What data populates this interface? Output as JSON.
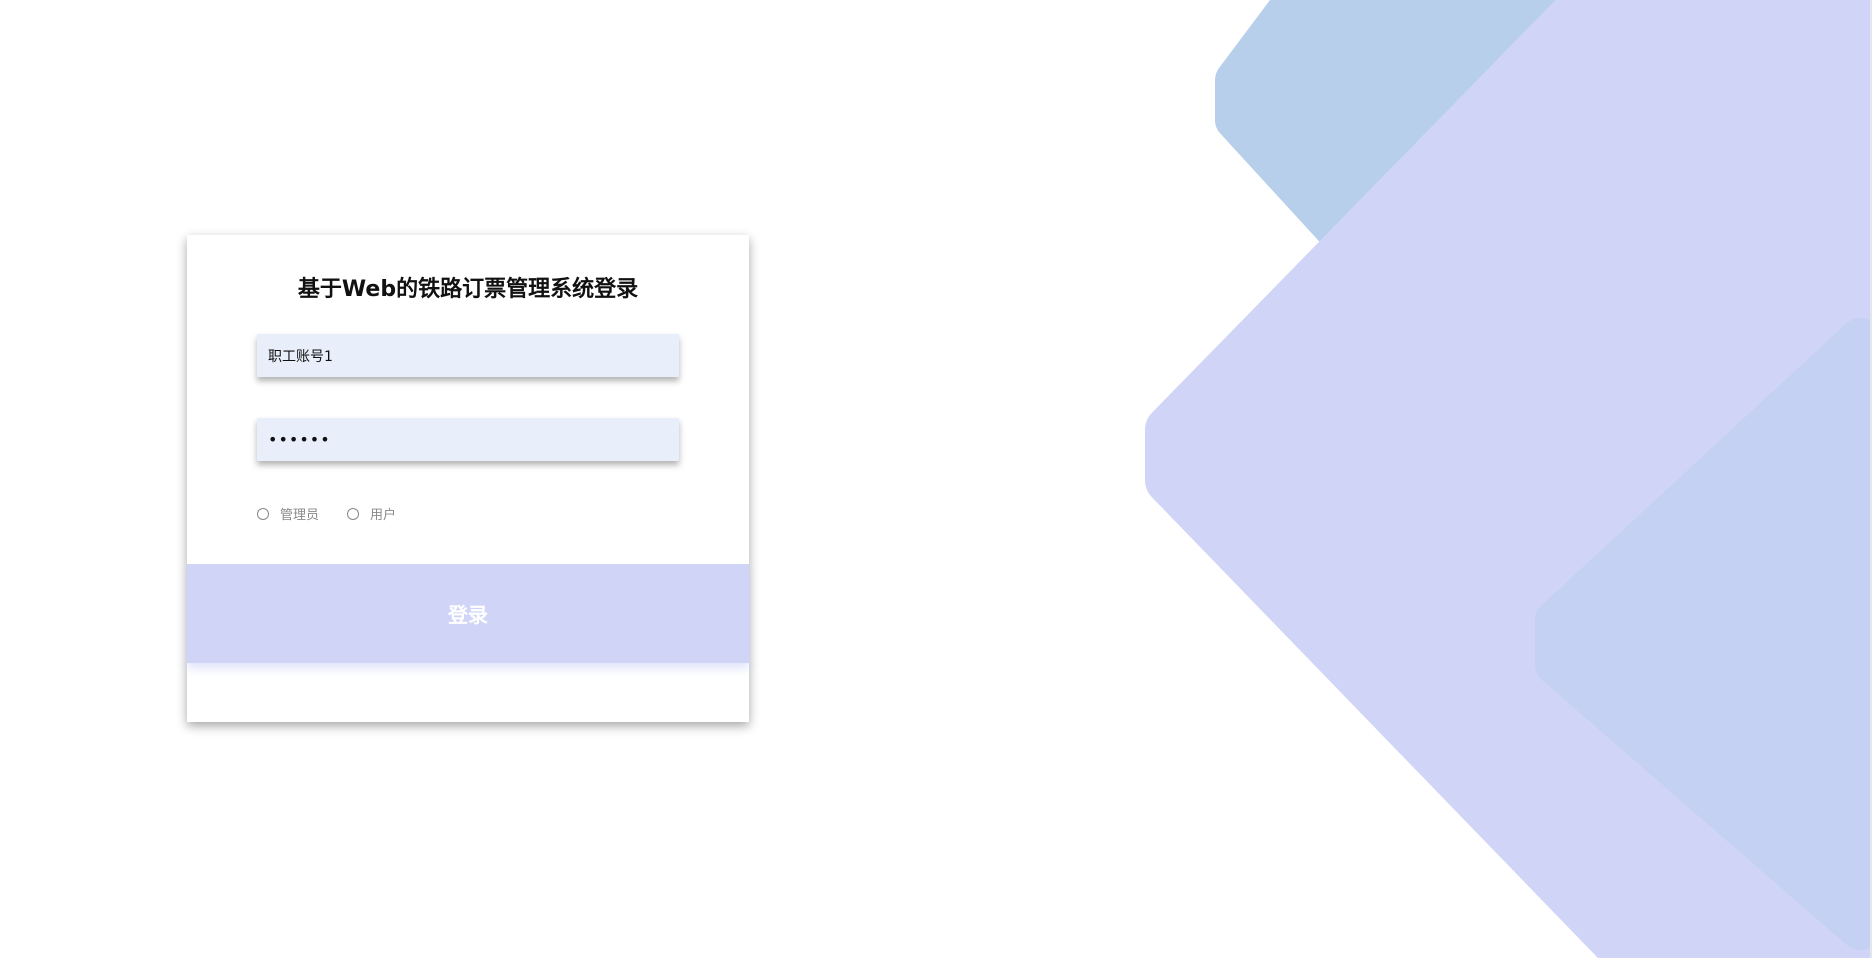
{
  "login": {
    "title": "基于Web的铁路订票管理系统登录",
    "username_value": "职工账号1",
    "password_value": "••••••",
    "roles": [
      {
        "label": "管理员",
        "selected": false
      },
      {
        "label": "用户",
        "selected": false
      }
    ],
    "submit_label": "登录"
  },
  "colors": {
    "shape_blue": "#b7cfeb",
    "shape_purple": "#d0d5f7",
    "shape_inner": "#c4d1f3",
    "button": "#d0d5f7",
    "input_bg": "#e8effb"
  }
}
